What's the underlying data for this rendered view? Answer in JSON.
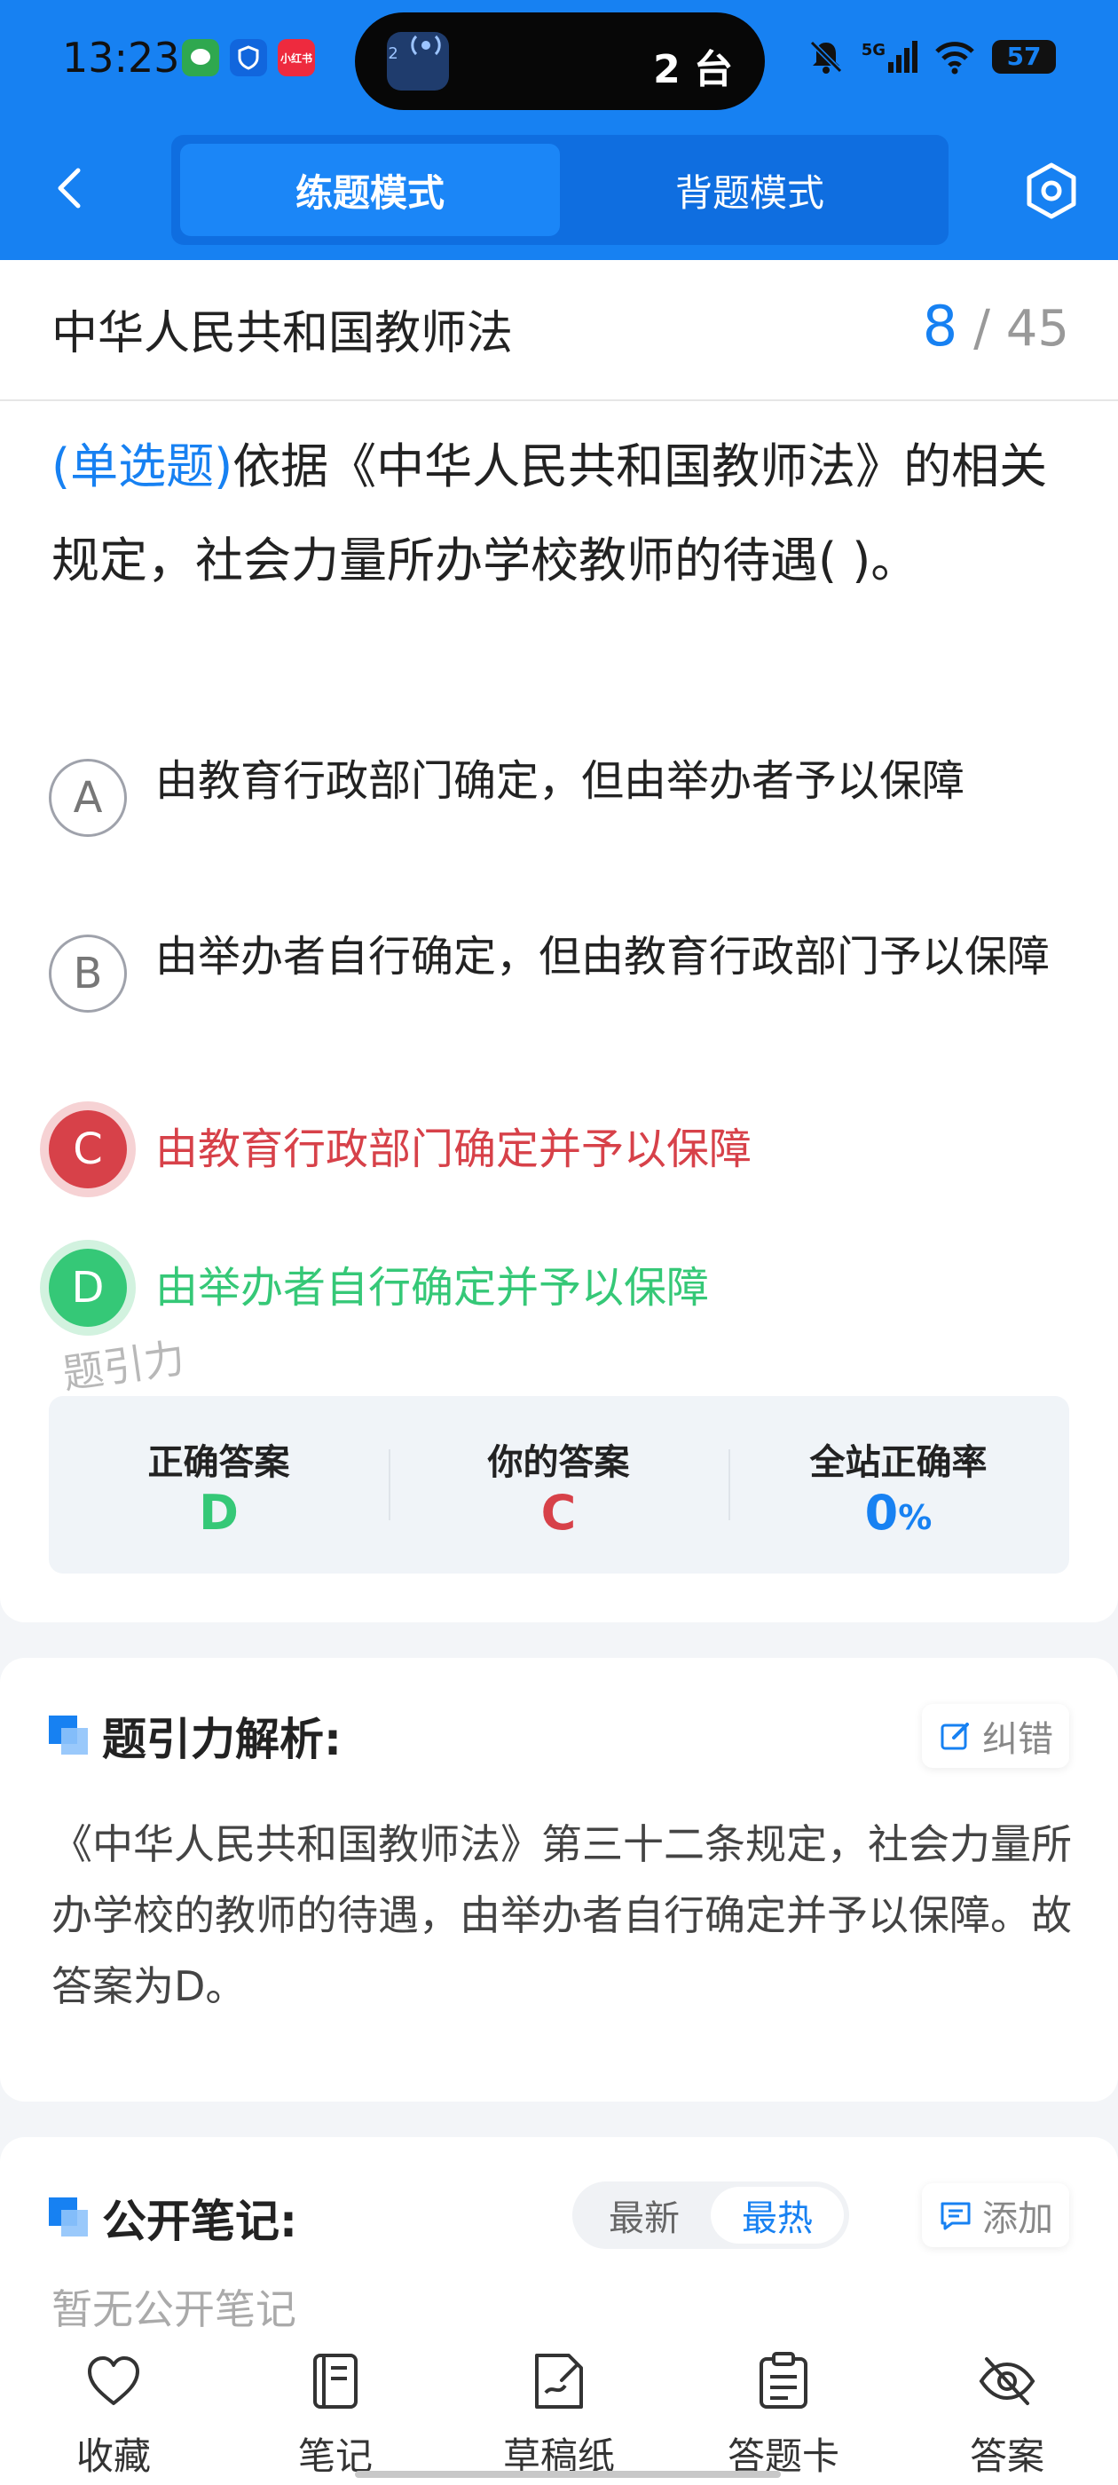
{
  "status_bar": {
    "time": "13:23",
    "pill_count": "2",
    "pill_text": "2 台",
    "network": "5G",
    "battery": "57",
    "app_icons": [
      {
        "name": "chat-app-icon",
        "color": "#2fa84f",
        "label": ""
      },
      {
        "name": "shield-app-icon",
        "color": "#1166dd",
        "label": ""
      },
      {
        "name": "xiaohongshu-app-icon",
        "color": "#ee2a3e",
        "label": "小红书"
      }
    ]
  },
  "nav": {
    "modes": [
      "练题模式",
      "背题模式"
    ],
    "active_mode": "练题模式"
  },
  "question": {
    "chapter": "中华人民共和国教师法",
    "current": "8",
    "total": "/ 45",
    "type_tag": "(单选题)",
    "text": "依据《中华人民共和国教师法》的相关规定，社会力量所办学校教师的待遇(    )。",
    "options": [
      {
        "letter": "A",
        "text": "由教育行政部门确定，但由举办者予以保障",
        "state": "normal"
      },
      {
        "letter": "B",
        "text": "由举办者自行确定，但由教育行政部门予以保障",
        "state": "normal"
      },
      {
        "letter": "C",
        "text": "由教育行政部门确定并予以保障",
        "state": "wrong"
      },
      {
        "letter": "D",
        "text": "由举办者自行确定并予以保障",
        "state": "correct"
      }
    ],
    "watermark": "题引力"
  },
  "result": {
    "correct_label": "正确答案",
    "correct_value": "D",
    "yours_label": "你的答案",
    "yours_value": "C",
    "rate_label": "全站正确率",
    "rate_value": "0",
    "rate_unit": "%",
    "colors": {
      "correct": "#35c877",
      "wrong": "#d74149",
      "rate": "#1781f2"
    }
  },
  "analysis": {
    "title": "题引力解析:",
    "correct_btn": "纠错",
    "text": "《中华人民共和国教师法》第三十二条规定，社会力量所办学校的教师的待遇，由举办者自行确定并予以保障。故答案为D。"
  },
  "notes": {
    "title": "公开笔记:",
    "sort_options": [
      "最新",
      "最热"
    ],
    "active_sort": "最热",
    "add_btn": "添加",
    "empty": "暂无公开笔记"
  },
  "bottom_tabs": [
    {
      "label": "收藏",
      "icon": "heart-icon"
    },
    {
      "label": "笔记",
      "icon": "notebook-icon"
    },
    {
      "label": "草稿纸",
      "icon": "draft-paper-icon"
    },
    {
      "label": "答题卡",
      "icon": "answer-sheet-icon"
    },
    {
      "label": "答案",
      "icon": "eye-off-icon"
    }
  ],
  "theme": {
    "primary": "#1781f2"
  }
}
